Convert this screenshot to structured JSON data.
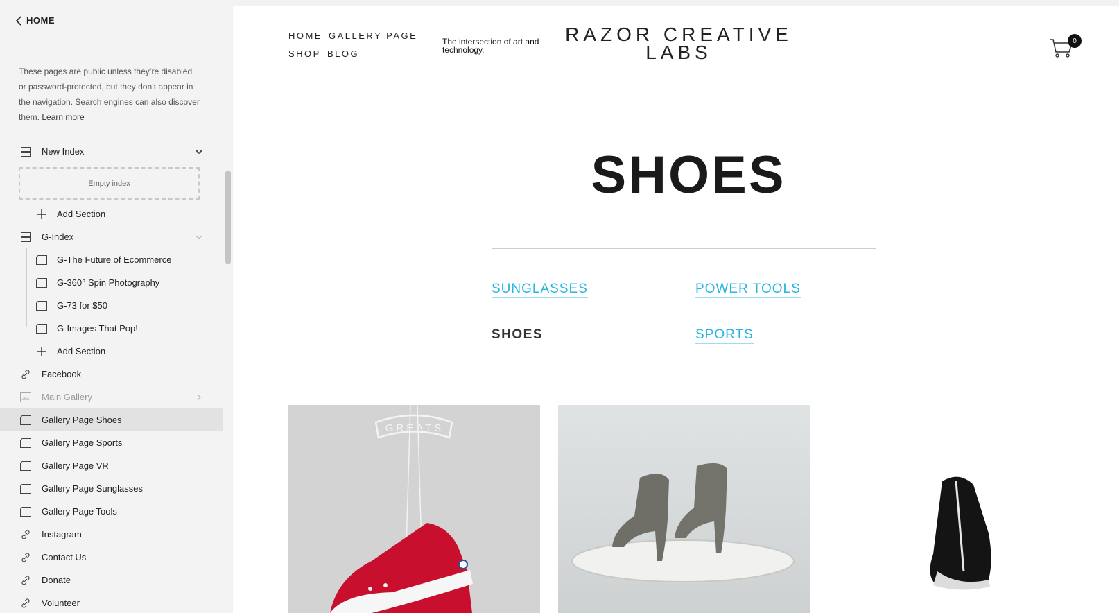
{
  "sidebar": {
    "home_label": "HOME",
    "note_text": "These pages are public unless they’re disabled or password-protected, but they don’t appear in the navigation. Search engines can also discover them.",
    "learn_more": "Learn more",
    "empty_index": "Empty index",
    "items": [
      {
        "label": "New Index",
        "icon": "index-icon"
      },
      {
        "label": "Add Section",
        "icon": "plus-icon"
      },
      {
        "label": "G-Index",
        "icon": "index-icon"
      },
      {
        "label": "G-The Future of Ecommerce",
        "icon": "page-icon"
      },
      {
        "label": "G-360° Spin Photography",
        "icon": "page-icon"
      },
      {
        "label": "G-73 for $50",
        "icon": "page-icon"
      },
      {
        "label": "G-Images That Pop!",
        "icon": "page-icon"
      },
      {
        "label": "Add Section",
        "icon": "plus-icon"
      },
      {
        "label": "Facebook",
        "icon": "link-icon"
      },
      {
        "label": "Main Gallery",
        "icon": "gallery-icon"
      },
      {
        "label": "Gallery Page Shoes",
        "icon": "page-icon"
      },
      {
        "label": "Gallery Page Sports",
        "icon": "page-icon"
      },
      {
        "label": "Gallery Page VR",
        "icon": "page-icon"
      },
      {
        "label": "Gallery Page Sunglasses",
        "icon": "page-icon"
      },
      {
        "label": "Gallery Page Tools",
        "icon": "page-icon"
      },
      {
        "label": "Instagram",
        "icon": "link-icon"
      },
      {
        "label": "Contact Us",
        "icon": "link-icon"
      },
      {
        "label": "Donate",
        "icon": "link-icon"
      },
      {
        "label": "Volunteer",
        "icon": "link-icon"
      }
    ]
  },
  "site": {
    "nav": [
      "HOME",
      "GALLERY PAGE",
      "SHOP",
      "BLOG"
    ],
    "tagline": "The intersection of art and technology.",
    "title": "RAZOR CREATIVE LABS",
    "cart_count": "0"
  },
  "page": {
    "title": "SHOES",
    "categories": [
      "SUNGLASSES",
      "POWER TOOLS",
      "SHOES",
      "SPORTS"
    ],
    "tile1_print": "GREATS"
  },
  "colors": {
    "link": "#28b6e0",
    "selected_row": "#e2e2e2"
  }
}
